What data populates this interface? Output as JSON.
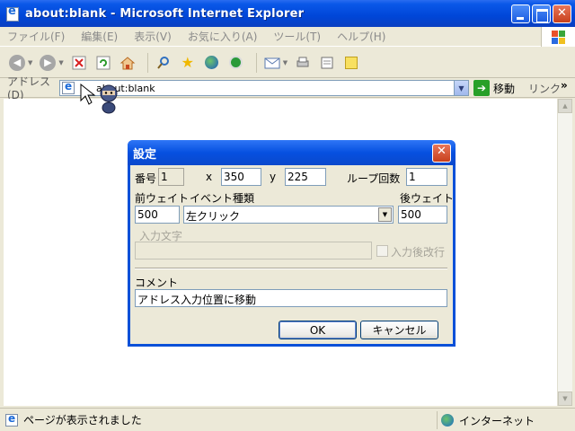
{
  "window": {
    "title": "about:blank - Microsoft Internet Explorer"
  },
  "menu": [
    "ファイル(F)",
    "編集(E)",
    "表示(V)",
    "お気に入り(A)",
    "ツール(T)",
    "ヘルプ(H)"
  ],
  "address": {
    "label": "アドレス(D)",
    "value": "about:blank",
    "go_label": "移動",
    "links_label": "リンク",
    "more": "»"
  },
  "status": {
    "text": "ページが表示されました",
    "zone": "インターネット"
  },
  "dialog": {
    "title": "設定",
    "number_label": "番号",
    "number_value": "1",
    "x_label": "x",
    "x_value": "350",
    "y_label": "y",
    "y_value": "225",
    "loop_label": "ループ回数",
    "loop_value": "1",
    "pre_wait_label": "前ウェイト",
    "pre_wait_value": "500",
    "event_type_label": "イベント種類",
    "event_type_value": "左クリック",
    "post_wait_label": "後ウェイト",
    "post_wait_value": "500",
    "input_text_label": "入力文字",
    "input_text_value": "",
    "post_input_label": "入力後改行",
    "comment_label": "コメント",
    "comment_value": "アドレス入力位置に移動",
    "ok_label": "OK",
    "cancel_label": "キャンセル"
  }
}
